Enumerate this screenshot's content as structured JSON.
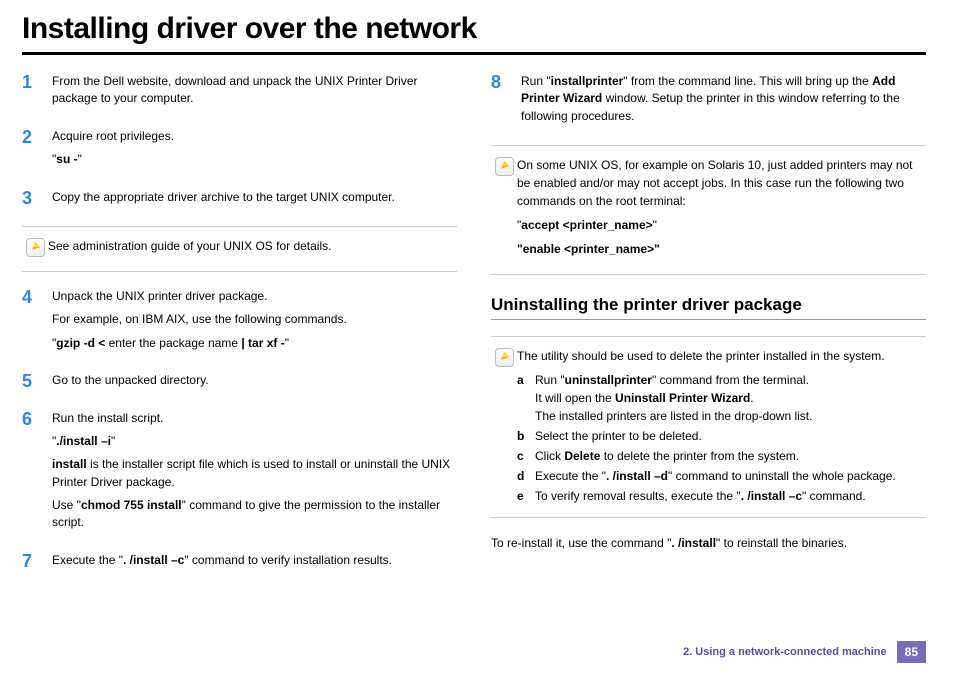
{
  "title": "Installing driver over the network",
  "left": {
    "step1": {
      "num": "1",
      "text": "From the Dell website, download and unpack the UNIX Printer Driver package to your computer."
    },
    "step2": {
      "num": "2",
      "l1": "Acquire root privileges.",
      "l2_pre": "\"",
      "l2_bold": "su -",
      "l2_post": "\""
    },
    "step3": {
      "num": "3",
      "text": "Copy the appropriate driver archive to the target UNIX computer."
    },
    "note1": "See administration guide of your UNIX OS for details.",
    "step4": {
      "num": "4",
      "l1": "Unpack the UNIX printer driver package.",
      "l2": "For example, on IBM AIX, use the following commands.",
      "l3_pre": "\"",
      "l3_b1": "gzip -d <",
      "l3_mid": " enter the package name ",
      "l3_b2": "| tar xf -",
      "l3_post": "\""
    },
    "step5": {
      "num": "5",
      "text": "Go to the unpacked directory."
    },
    "step6": {
      "num": "6",
      "l1": "Run the install script.",
      "l2_pre": "\"",
      "l2_bold": "./install –i",
      "l2_post": "\"",
      "l3_b": "install",
      "l3_rest": " is the installer script file which is used to install or uninstall the UNIX Printer Driver package.",
      "l4_pre": "Use \"",
      "l4_bold": "chmod 755 install",
      "l4_post": "\" command to give the permission to the installer script."
    },
    "step7": {
      "num": "7",
      "pre": "Execute the \"",
      "bold": ". /install –c",
      "post": "\" command to verify installation results."
    }
  },
  "right": {
    "step8": {
      "num": "8",
      "p1_pre": "Run \"",
      "p1_b1": "installprinter",
      "p1_mid": "\" from the command line. This will bring up the ",
      "p1_b2": "Add Printer Wizard",
      "p1_post": " window. Setup the printer in this window referring to the following procedures."
    },
    "note2": {
      "intro": "On some UNIX OS, for example on Solaris 10, just added printers may not be enabled and/or may not accept jobs. In this case run the following two commands on the root terminal:",
      "c1_pre": "\"",
      "c1_bold": "accept <printer_name>",
      "c1_post": "\"",
      "c2_bold": "\"enable <printer_name>\""
    },
    "subhead": "Uninstalling the printer driver package",
    "note3": {
      "intro": "The utility should be used to delete the printer installed in the system.",
      "a": {
        "letter": "a",
        "pre": "Run \"",
        "bold": "uninstallprinter",
        "post": "\" command from the terminal.",
        "line2_pre": "It will open the ",
        "line2_bold": "Uninstall Printer Wizard",
        "line2_post": ".",
        "line3": "The installed printers are listed in the drop-down list."
      },
      "b": {
        "letter": "b",
        "text": "Select the printer to be deleted."
      },
      "c": {
        "letter": "c",
        "pre": "Click ",
        "bold": "Delete",
        "post": " to delete the printer from the system."
      },
      "d": {
        "letter": "d",
        "pre": "Execute the \"",
        "bold": ". /install –d",
        "post": "\" command to uninstall the whole package."
      },
      "e": {
        "letter": "e",
        "pre": "To verify removal results, execute the \"",
        "bold": ". /install –c",
        "post": "\" command."
      }
    },
    "reinstall": {
      "pre": "To re-install it, use the command \"",
      "bold": ". /install",
      "post": "\" to reinstall the binaries."
    }
  },
  "footer": {
    "chapter": "2.  Using a network-connected machine",
    "page": "85"
  }
}
